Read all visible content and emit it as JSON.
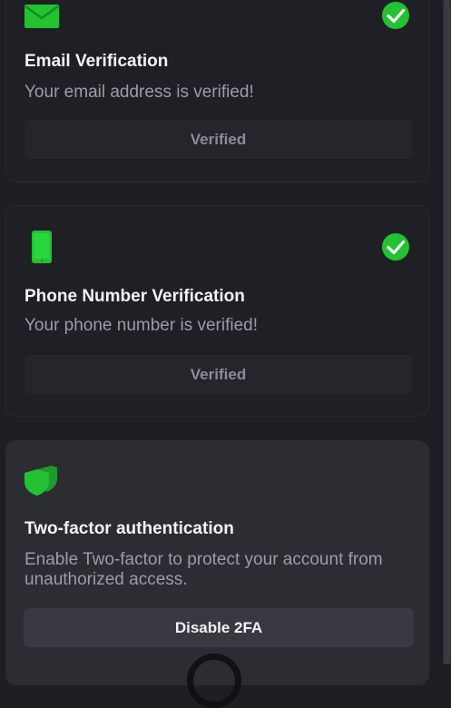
{
  "colors": {
    "background": "#1e1f24",
    "card_active": "#2c2d33",
    "accent_green": "#22c232",
    "button": "#393a41"
  },
  "email_card": {
    "icon": "envelope-icon",
    "status_icon": "check-circle-icon",
    "title": "Email Verification",
    "description": "Your email address is verified!",
    "button_label": "Verified"
  },
  "phone_card": {
    "icon": "phone-icon",
    "status_icon": "check-circle-icon",
    "title": "Phone Number Verification",
    "description": "Your phone number is verified!",
    "button_label": "Verified"
  },
  "twofa_card": {
    "icon": "shield-icon",
    "title": "Two-factor authentication",
    "description": "Enable Two-factor to protect your account from unauthorized access.",
    "button_label": "Disable 2FA"
  }
}
